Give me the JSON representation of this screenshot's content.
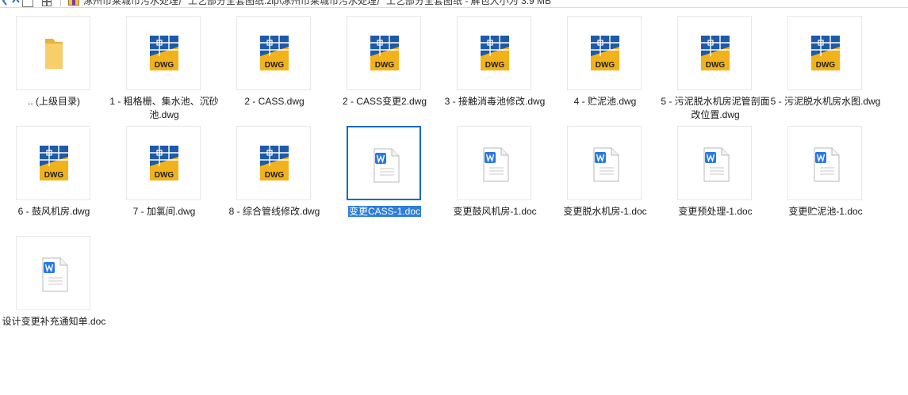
{
  "window": {
    "title": "涿州市莱城市污水处理厂工艺部分全套图纸.zip\\涿州市莱城市污水处理厂工艺部分全套图纸 - 解包大小为 3.9 MB"
  },
  "files": [
    {
      "name": ".. (上级目录)",
      "type": "folder"
    },
    {
      "name": "1 - 粗格栅、集水池、沉砂池.dwg",
      "type": "dwg"
    },
    {
      "name": "2 - CASS.dwg",
      "type": "dwg"
    },
    {
      "name": "2 - CASS变更2.dwg",
      "type": "dwg"
    },
    {
      "name": "3 - 接触消毒池修改.dwg",
      "type": "dwg"
    },
    {
      "name": "4 - 贮泥池.dwg",
      "type": "dwg"
    },
    {
      "name": "5 - 污泥脱水机房泥管剖面改位置.dwg",
      "type": "dwg"
    },
    {
      "name": "5 - 污泥脱水机房水图.dwg",
      "type": "dwg"
    },
    {
      "name": "6 - 鼓风机房.dwg",
      "type": "dwg"
    },
    {
      "name": "7 - 加氯间.dwg",
      "type": "dwg"
    },
    {
      "name": "8 - 综合管线修改.dwg",
      "type": "dwg"
    },
    {
      "name": "变更CASS-1.doc",
      "type": "doc",
      "selected": true
    },
    {
      "name": "变更鼓风机房-1.doc",
      "type": "doc"
    },
    {
      "name": "变更脱水机房-1.doc",
      "type": "doc"
    },
    {
      "name": "变更预处理-1.doc",
      "type": "doc"
    },
    {
      "name": "变更贮泥池-1.doc",
      "type": "doc"
    },
    {
      "name": "设计变更补充通知单.doc",
      "type": "doc"
    }
  ],
  "icons": {
    "folder": "folder-icon",
    "dwg": "dwg-file-icon",
    "doc": "word-doc-icon"
  },
  "dwg_badge": "DWG",
  "colors": {
    "selection_border": "#0a6ac4",
    "selection_label_bg": "#2f7ed8",
    "dwg_blue": "#1e5aa8",
    "dwg_yellow": "#f2b21b",
    "word_blue": "#2b78e4"
  }
}
